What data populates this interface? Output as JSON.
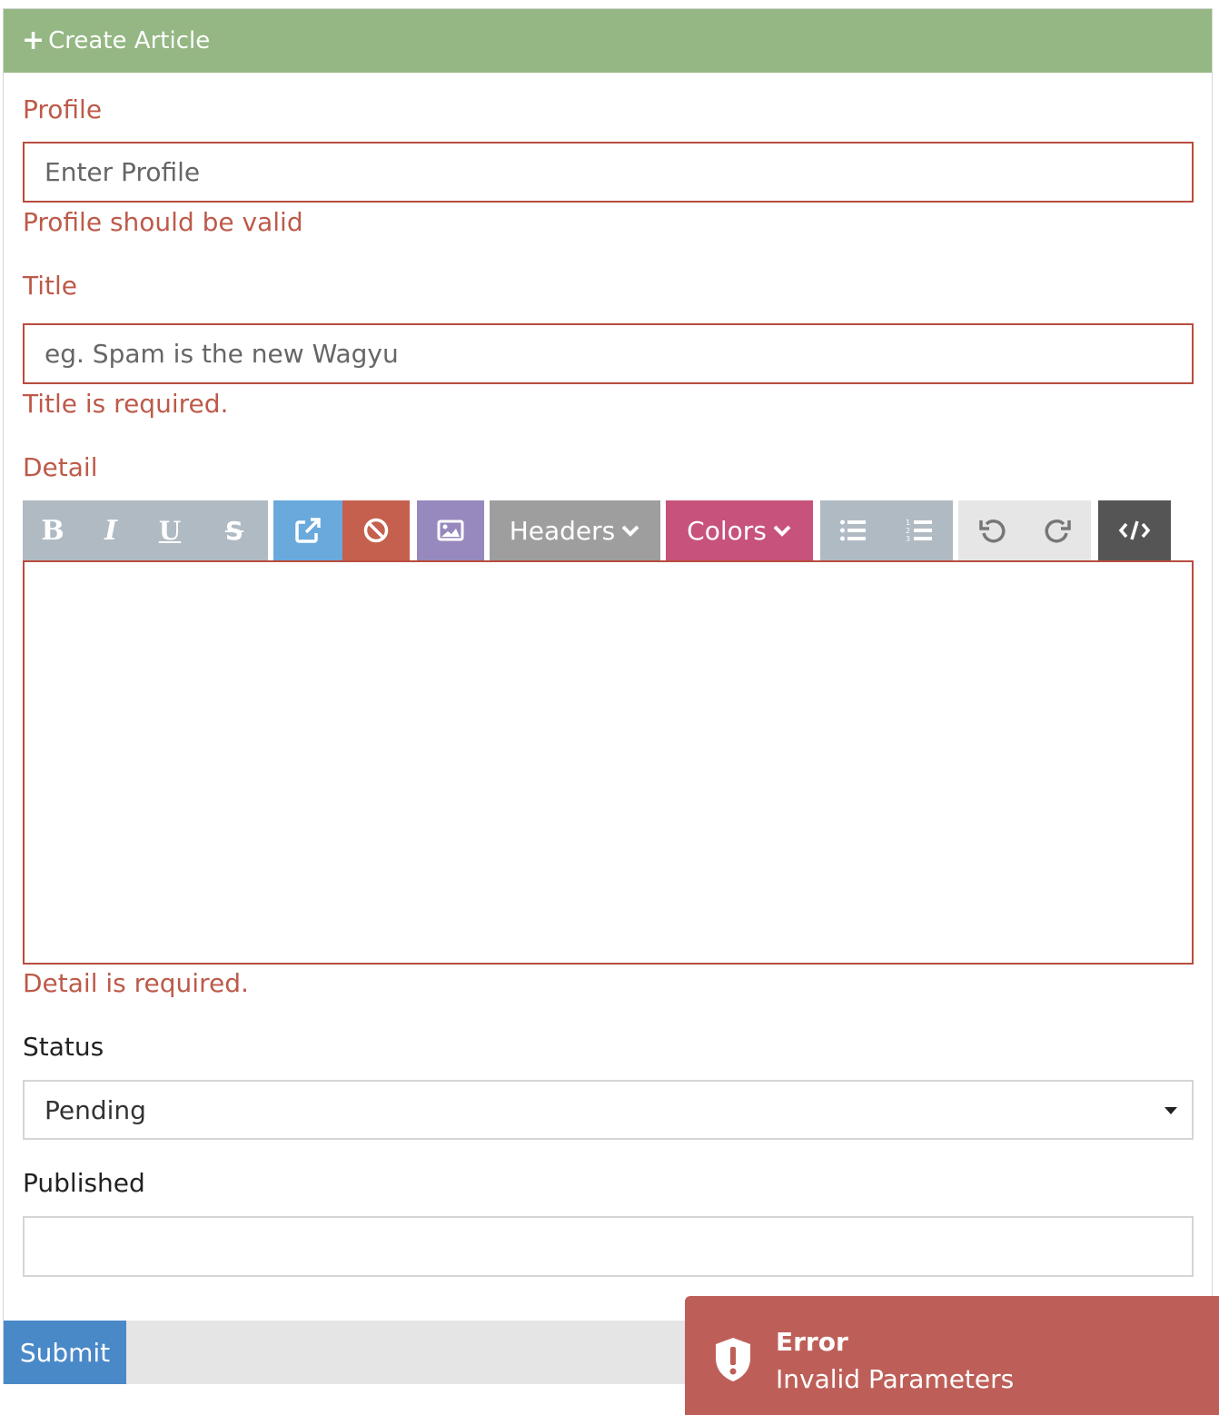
{
  "header": {
    "icon": "plus-icon",
    "title": "Create Article"
  },
  "profile": {
    "label": "Profile",
    "placeholder": "Enter Profile",
    "value": "",
    "error": "Profile should be valid"
  },
  "title_field": {
    "label": "Title",
    "placeholder": "eg. Spam is the new Wagyu",
    "value": "",
    "error": "Title is required."
  },
  "detail": {
    "label": "Detail",
    "error": "Detail is required.",
    "toolbar": {
      "headers_label": "Headers",
      "colors_label": "Colors",
      "icons": [
        "bold-icon",
        "italic-icon",
        "underline-icon",
        "strikethrough-icon",
        "link-icon",
        "unlink-icon",
        "image-icon",
        "chevron-down-icon",
        "bulleted-list-icon",
        "numbered-list-icon",
        "undo-icon",
        "redo-icon",
        "code-view-icon"
      ]
    }
  },
  "status": {
    "label": "Status",
    "selected": "Pending"
  },
  "published": {
    "label": "Published",
    "value": ""
  },
  "submit_label": "Submit",
  "toast": {
    "icon": "shield-alert-icon",
    "title": "Error",
    "message": "Invalid Parameters"
  },
  "colors": {
    "header": "#94b783",
    "error": "#bd5a4a",
    "submit": "#4a89c8",
    "toast": "#bd5f58",
    "tb_text": "#b0bac3",
    "tb_link": "#69a9dc",
    "tb_unlink": "#c4604d",
    "tb_image": "#9789bd",
    "tb_headers": "#9e9e9e",
    "tb_colors": "#c7527c",
    "tb_undo": "#e6e6e6",
    "tb_code": "#555555"
  }
}
